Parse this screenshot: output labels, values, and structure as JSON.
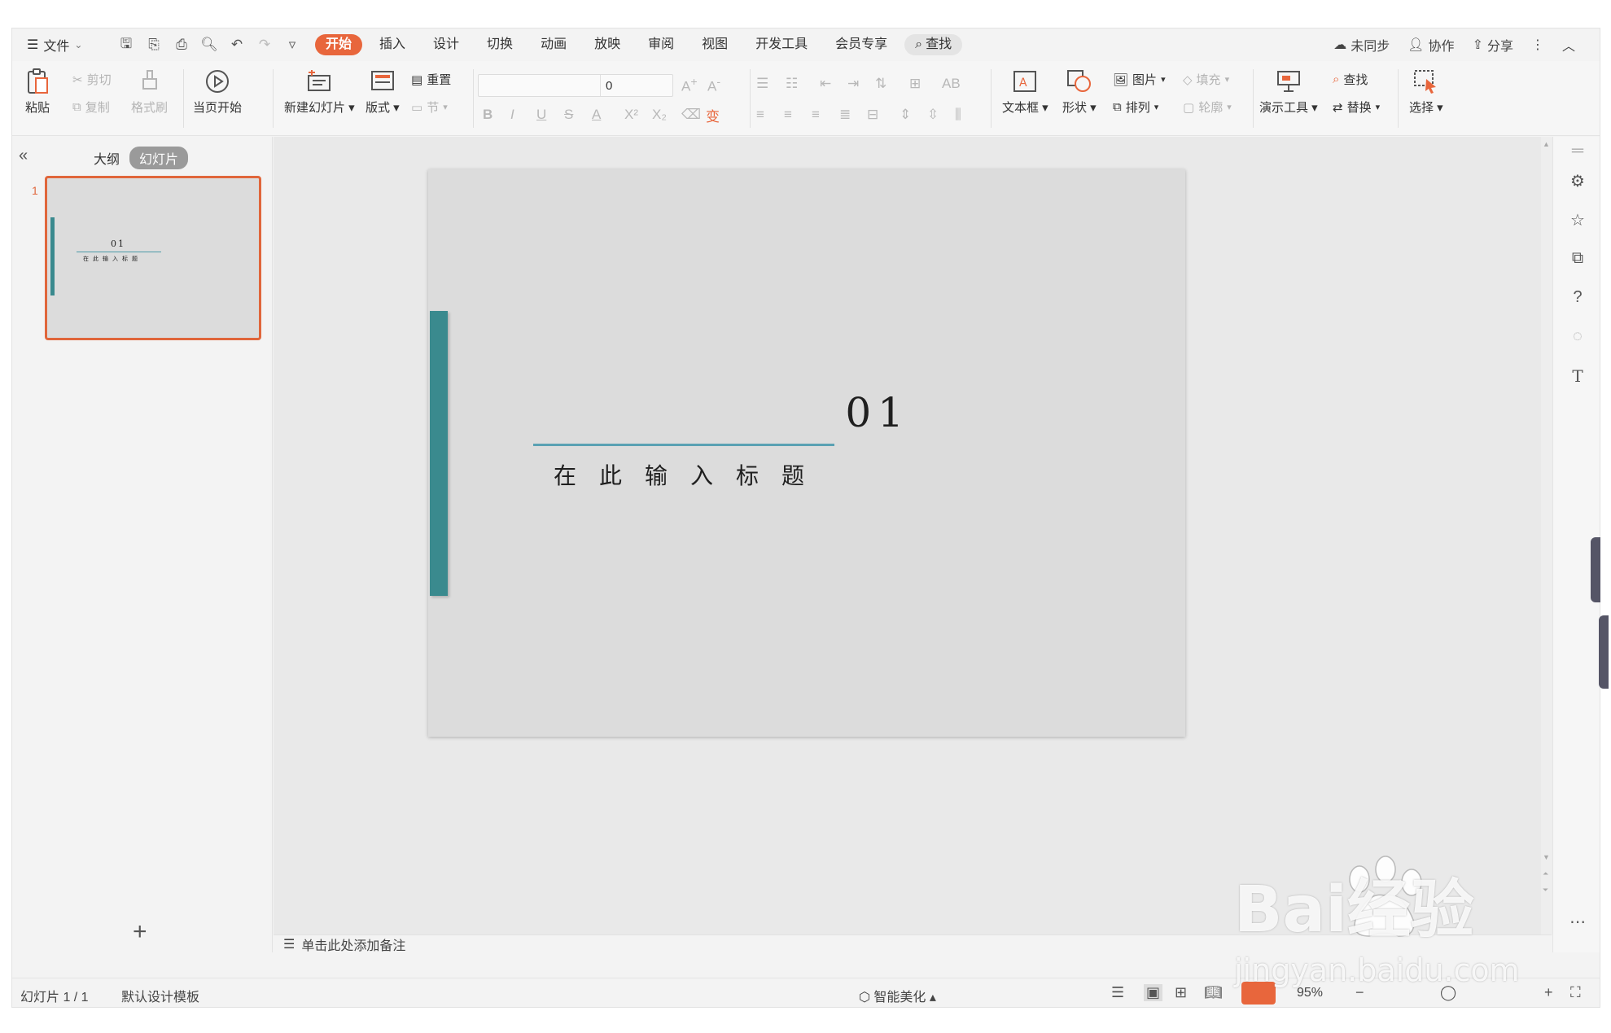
{
  "window": {
    "menu_label": "文件",
    "tabs": [
      "开始",
      "插入",
      "设计",
      "切换",
      "动画",
      "放映",
      "审阅",
      "视图",
      "开发工具",
      "会员专享"
    ],
    "search_label": "查找",
    "right": {
      "sync": "未同步",
      "collab": "协作",
      "share": "分享"
    },
    "accent_color": "#e8663c"
  },
  "ribbon": {
    "paste": "粘贴",
    "cut": "剪切",
    "copy": "复制",
    "format_painter": "格式刷",
    "from_current": "当页开始",
    "new_slide": "新建幻灯片",
    "layout": "版式",
    "reset": "重置",
    "section": "节",
    "font_name": "",
    "font_size": "0",
    "textbox": "文本框",
    "shape": "形状",
    "picture": "图片",
    "fill": "填充",
    "arrange": "排列",
    "outline": "轮廓",
    "present_tools": "演示工具",
    "find": "查找",
    "replace": "替换",
    "select": "选择"
  },
  "left_panel": {
    "outline_tab": "大纲",
    "slides_tab": "幻灯片",
    "thumb_number": "1",
    "add_label": "+"
  },
  "slide": {
    "number": "01",
    "title": "在此输入标题",
    "accent_color": "#3a8a8e",
    "underline_color": "#5aa1b3"
  },
  "notes": {
    "placeholder": "单击此处添加备注"
  },
  "status": {
    "slide_count": "幻灯片 1 / 1",
    "template": "默认设计模板",
    "beautify": "智能美化",
    "zoom": "95%"
  },
  "watermark": {
    "line1": "Bai经验",
    "line2": "jingyan.baidu.com"
  }
}
